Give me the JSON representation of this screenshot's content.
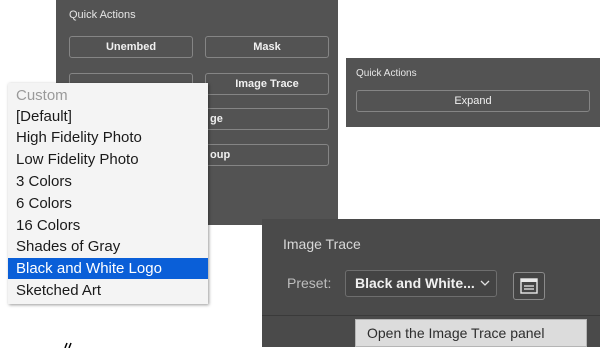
{
  "left_panel": {
    "title": "Quick Actions",
    "buttons": [
      "Unembed",
      "Mask",
      "",
      "Image Trace",
      "ge",
      "oup"
    ]
  },
  "right_panel": {
    "title": "Quick Actions",
    "expand_label": "Expand"
  },
  "preset_menu": {
    "items": [
      {
        "label": "Custom",
        "state": "disabled"
      },
      {
        "label": "[Default]",
        "state": "normal"
      },
      {
        "label": "High Fidelity Photo",
        "state": "normal"
      },
      {
        "label": "Low Fidelity Photo",
        "state": "normal"
      },
      {
        "label": "3 Colors",
        "state": "normal"
      },
      {
        "label": "6 Colors",
        "state": "normal"
      },
      {
        "label": "16 Colors",
        "state": "normal"
      },
      {
        "label": "Shades of Gray",
        "state": "normal"
      },
      {
        "label": "Black and White Logo",
        "state": "selected"
      },
      {
        "label": "Sketched Art",
        "state": "normal"
      }
    ]
  },
  "image_trace": {
    "title": "Image Trace",
    "preset_label": "Preset:",
    "preset_value": "Black and White...",
    "open_panel_tooltip": "Open the Image Trace panel"
  },
  "icons": {
    "select_chevron": "chevron-down-icon",
    "panel_button": "panel-icon"
  },
  "colors": {
    "panel_bg": "#535353",
    "menu_bg": "#f4f4f4",
    "selection": "#0a5fd8",
    "tooltip_bg": "#dcdcdc"
  }
}
